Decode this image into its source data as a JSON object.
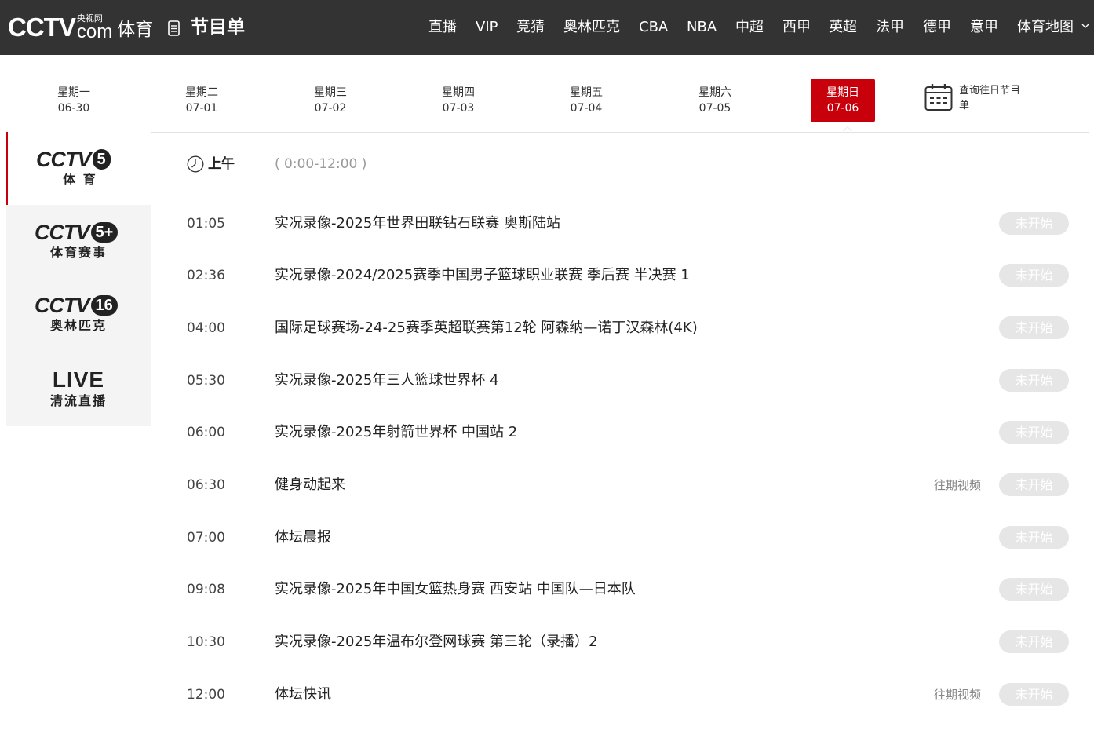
{
  "header": {
    "logo_cctv": "CCTV",
    "logo_small": "央视网",
    "logo_com": "com",
    "logo_sport": "体育",
    "page_title": "节目单",
    "nav": [
      "直播",
      "VIP",
      "竞猜",
      "奥林匹克",
      "CBA",
      "NBA",
      "中超",
      "西甲",
      "英超",
      "法甲",
      "德甲",
      "意甲",
      "体育地图"
    ]
  },
  "days": [
    {
      "weekday": "星期一",
      "date": "06-30"
    },
    {
      "weekday": "星期二",
      "date": "07-01"
    },
    {
      "weekday": "星期三",
      "date": "07-02"
    },
    {
      "weekday": "星期四",
      "date": "07-03"
    },
    {
      "weekday": "星期五",
      "date": "07-04"
    },
    {
      "weekday": "星期六",
      "date": "07-05"
    },
    {
      "weekday": "星期日",
      "date": "07-06"
    }
  ],
  "active_day": 6,
  "query_label": "查询往日节目单",
  "channels": [
    {
      "brand": "CCTV",
      "num": "5",
      "sub": "体 育"
    },
    {
      "brand": "CCTV",
      "num": "5+",
      "sub": "体育赛事"
    },
    {
      "brand": "CCTV",
      "num": "16",
      "sub": "奥林匹克"
    },
    {
      "brand": "LIVE",
      "num": "",
      "sub": "清流直播"
    }
  ],
  "active_channel": 0,
  "period": {
    "label": "上午",
    "range": "( 0:00-12:00 )"
  },
  "programs": [
    {
      "time": "01:05",
      "title": "实况录像-2025年世界田联钻石联赛 奥斯陆站",
      "replay": "",
      "status": "未开始"
    },
    {
      "time": "02:36",
      "title": "实况录像-2024/2025赛季中国男子篮球职业联赛 季后赛  半决赛 1",
      "replay": "",
      "status": "未开始"
    },
    {
      "time": "04:00",
      "title": "国际足球赛场-24-25赛季英超联赛第12轮 阿森纳—诺丁汉森林(4K)",
      "replay": "",
      "status": "未开始"
    },
    {
      "time": "05:30",
      "title": "实况录像-2025年三人篮球世界杯 4",
      "replay": "",
      "status": "未开始"
    },
    {
      "time": "06:00",
      "title": "实况录像-2025年射箭世界杯 中国站 2",
      "replay": "",
      "status": "未开始"
    },
    {
      "time": "06:30",
      "title": "健身动起来",
      "replay": "往期视频",
      "status": "未开始"
    },
    {
      "time": "07:00",
      "title": "体坛晨报",
      "replay": "",
      "status": "未开始"
    },
    {
      "time": "09:08",
      "title": "实况录像-2025年中国女篮热身赛 西安站 中国队—日本队",
      "replay": "",
      "status": "未开始"
    },
    {
      "time": "10:30",
      "title": "实况录像-2025年温布尔登网球赛 第三轮（录播）2",
      "replay": "",
      "status": "未开始"
    },
    {
      "time": "12:00",
      "title": "体坛快讯",
      "replay": "往期视频",
      "status": "未开始"
    }
  ],
  "colors": {
    "header_bg": "#333333",
    "accent": "#c8000b",
    "status_bg": "#e6e6e6"
  }
}
